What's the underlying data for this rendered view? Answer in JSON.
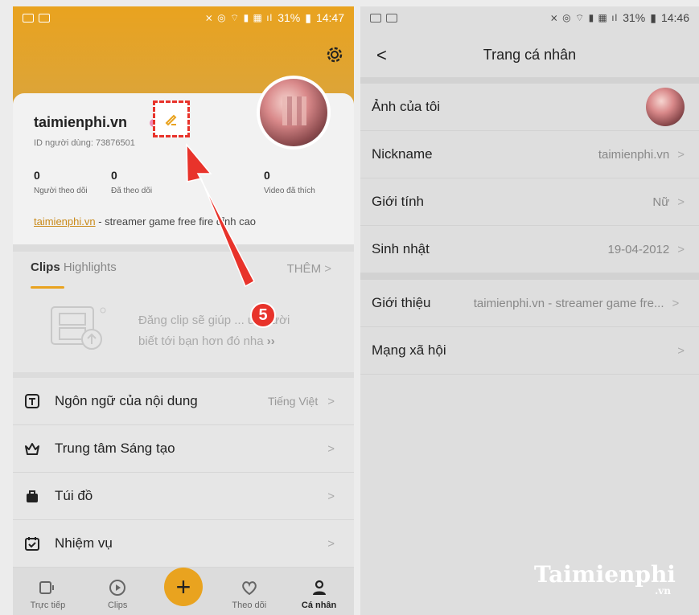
{
  "left": {
    "status": {
      "percent": "31%",
      "time": "14:47"
    },
    "profile": {
      "username": "taimienphi.vn",
      "user_id": "ID người dùng: 73876501",
      "stats": [
        {
          "value": "0",
          "label": "Người theo dõi"
        },
        {
          "value": "0",
          "label": "Đã theo dõi"
        },
        {
          "value": "",
          "label": "n"
        },
        {
          "value": "0",
          "label": "Video đã thích"
        }
      ],
      "bio_link": "taimienphi.vn",
      "bio_rest": " - streamer game free fire đỉnh cao"
    },
    "clips": {
      "tab_active": "Clips",
      "tab_other": "Highlights",
      "more": "THÊM",
      "empty_line1": "Đăng clip sẽ giúp ... u người",
      "empty_line2": "biết tới bạn hơn đó nha"
    },
    "step_badge": "5",
    "menu": [
      {
        "label": "Ngôn ngữ của nội dung",
        "value": "Tiếng Việt",
        "icon": "text-icon"
      },
      {
        "label": "Trung tâm Sáng tạo",
        "value": "",
        "icon": "crown-icon"
      },
      {
        "label": "Túi đồ",
        "value": "",
        "icon": "bag-icon"
      },
      {
        "label": "Nhiệm vụ",
        "value": "",
        "icon": "calendar-check-icon"
      }
    ],
    "nav": [
      {
        "label": "Trực tiếp",
        "icon": "live-icon"
      },
      {
        "label": "Clips",
        "icon": "play-icon"
      },
      {
        "label": "Theo dõi",
        "icon": "heart-icon"
      },
      {
        "label": "Cá nhân",
        "icon": "person-icon"
      }
    ]
  },
  "right": {
    "status": {
      "percent": "31%",
      "time": "14:46"
    },
    "title": "Trang cá nhân",
    "rows": [
      {
        "label": "Ảnh của tôi",
        "value": ""
      },
      {
        "label": "Nickname",
        "value": "taimienphi.vn"
      },
      {
        "label": "Giới tính",
        "value": "Nữ"
      },
      {
        "label": "Sinh nhật",
        "value": "19-04-2012"
      },
      {
        "label": "Giới thiệu",
        "value": "taimienphi.vn  - streamer game fre..."
      },
      {
        "label": "Mạng xã hội",
        "value": ""
      }
    ],
    "watermark": "Taimienphi",
    "watermark_suffix": ".vn"
  },
  "colors": {
    "accent": "#e9a31f",
    "callout": "#e8332b"
  }
}
